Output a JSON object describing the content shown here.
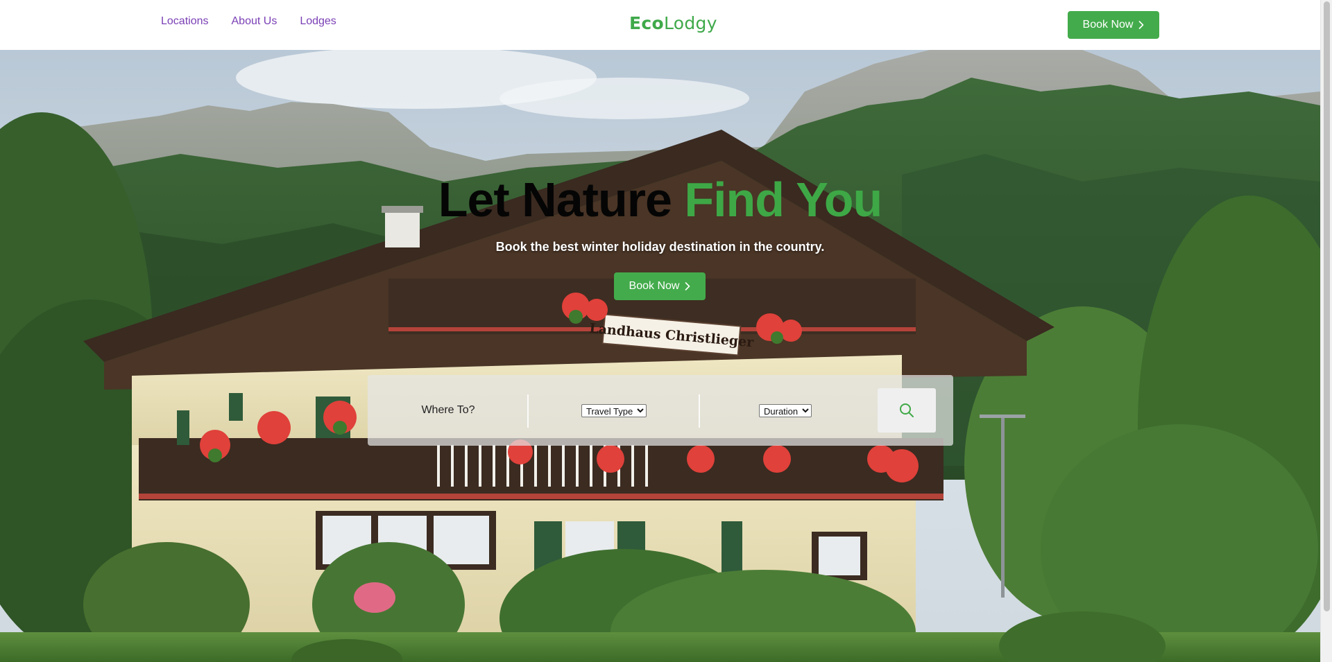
{
  "header": {
    "nav": [
      "Locations",
      "About Us",
      "Lodges"
    ],
    "logo_bold": "Eco",
    "logo_rest": "Lodgy",
    "book_now": "Book Now"
  },
  "hero": {
    "title_dark": "Let Nature",
    "title_green": "Find You",
    "subtitle": "Book the best winter holiday destination in the country.",
    "book_now": "Book Now",
    "sign_text": "Landhaus Christlieger"
  },
  "search": {
    "where_label": "Where To?",
    "travel_type": {
      "selected": "Travel Type"
    },
    "duration": {
      "selected": "Duration"
    }
  },
  "colors": {
    "accent_green": "#43ab4b",
    "nav_purple": "#7a3fb5"
  },
  "icons": [
    "chevron-right-icon",
    "search-icon"
  ]
}
